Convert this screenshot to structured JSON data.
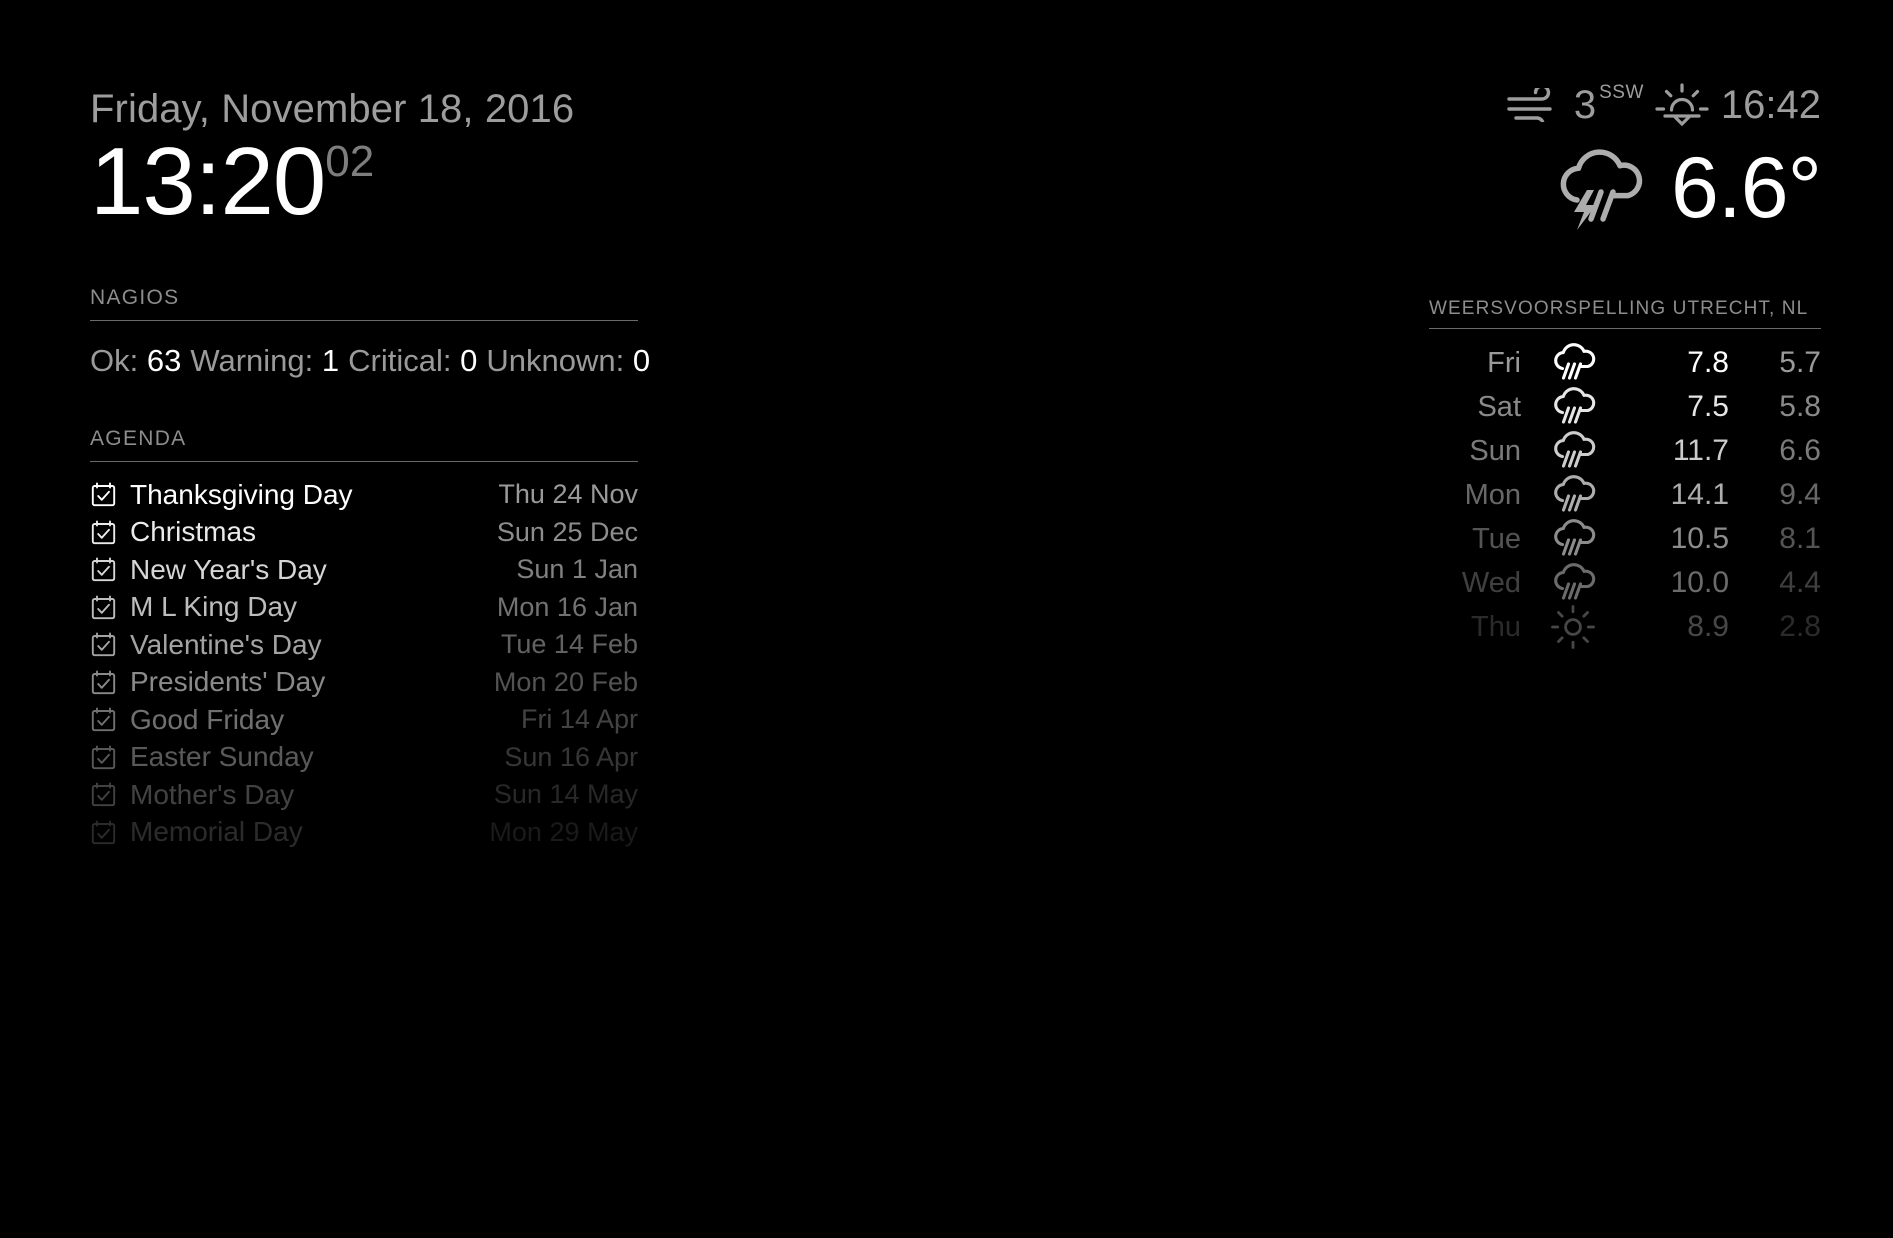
{
  "clock": {
    "date": "Friday, November 18, 2016",
    "time": "13:20",
    "seconds": "02"
  },
  "nagios": {
    "title": "Nagios",
    "ok_label": "Ok:",
    "ok_value": "63",
    "warning_label": "Warning:",
    "warning_value": "1",
    "critical_label": "Critical:",
    "critical_value": "0",
    "unknown_label": "Unknown:",
    "unknown_value": "0"
  },
  "agenda": {
    "title": "Agenda",
    "icon": "calendar-check-icon",
    "items": [
      {
        "name": "Thanksgiving Day",
        "date": "Thu 24 Nov",
        "opacity": 1.0
      },
      {
        "name": "Christmas",
        "date": "Sun 25 Dec",
        "opacity": 0.92
      },
      {
        "name": "New Year's Day",
        "date": "Sun 1 Jan",
        "opacity": 0.84
      },
      {
        "name": "M L King Day",
        "date": "Mon 16 Jan",
        "opacity": 0.74
      },
      {
        "name": "Valentine's Day",
        "date": "Tue 14 Feb",
        "opacity": 0.64
      },
      {
        "name": "Presidents' Day",
        "date": "Mon 20 Feb",
        "opacity": 0.54
      },
      {
        "name": "Good Friday",
        "date": "Fri 14 Apr",
        "opacity": 0.44
      },
      {
        "name": "Easter Sunday",
        "date": "Sun 16 Apr",
        "opacity": 0.35
      },
      {
        "name": "Mother's Day",
        "date": "Sun 14 May",
        "opacity": 0.26
      },
      {
        "name": "Memorial Day",
        "date": "Mon 29 May",
        "opacity": 0.17
      }
    ]
  },
  "current_weather": {
    "wind_icon": "wind-icon",
    "wind_speed": "3",
    "wind_direction": "SSW",
    "sunset_icon": "sunset-icon",
    "sunset_time": "16:42",
    "condition_icon": "thunderstorm-rain-icon",
    "temperature": "6.6°"
  },
  "forecast": {
    "title": "Weersvoorspelling Utrecht, NL",
    "rows": [
      {
        "day": "Fri",
        "icon": "rain-cloud-icon",
        "high": "7.8",
        "low": "5.7",
        "opacity": 1.0
      },
      {
        "day": "Sat",
        "icon": "rain-cloud-icon",
        "high": "7.5",
        "low": "5.8",
        "opacity": 0.9
      },
      {
        "day": "Sun",
        "icon": "rain-cloud-icon",
        "high": "11.7",
        "low": "6.6",
        "opacity": 0.8
      },
      {
        "day": "Mon",
        "icon": "rain-cloud-icon",
        "high": "14.1",
        "low": "9.4",
        "opacity": 0.68
      },
      {
        "day": "Tue",
        "icon": "rain-cloud-icon",
        "high": "10.5",
        "low": "8.1",
        "opacity": 0.55
      },
      {
        "day": "Wed",
        "icon": "rain-cloud-icon",
        "high": "10.0",
        "low": "4.4",
        "opacity": 0.42
      },
      {
        "day": "Thu",
        "icon": "sun-icon",
        "high": "8.9",
        "low": "2.8",
        "opacity": 0.28
      }
    ]
  },
  "colors": {
    "background": "#000000",
    "primary_text": "#ffffff",
    "secondary_text": "#9a9a9a",
    "divider": "#6a6a6a"
  }
}
